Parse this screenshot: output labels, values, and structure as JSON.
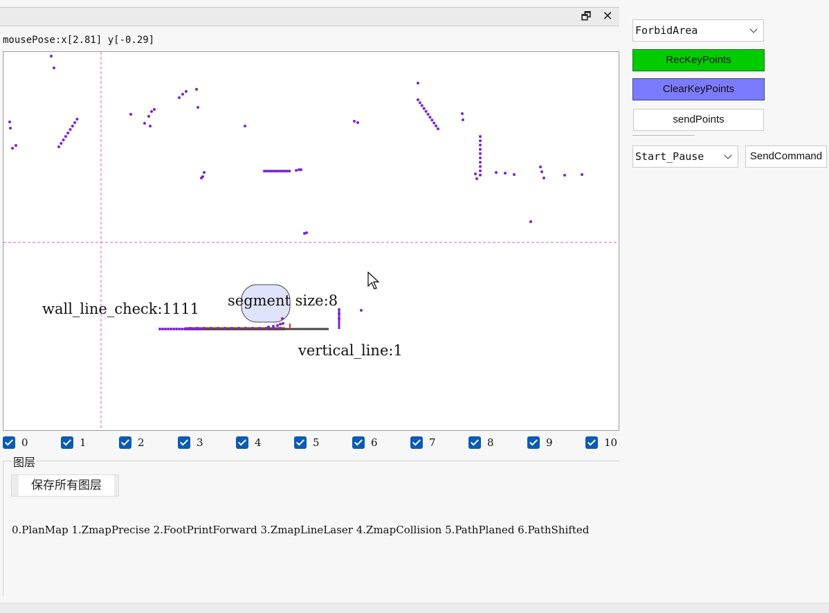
{
  "window": {
    "restore_icon": "restore-icon",
    "close_icon": "close-icon",
    "restore_glyph": "🗗",
    "close_glyph": "✕"
  },
  "mouse_pose": "mousePose:x[2.81] y[-0.29]",
  "canvas_labels": {
    "wall_line_check": "wall_line_check:1111",
    "segment_size": "segment size:8",
    "vertical_line": "vertical_line:1"
  },
  "layer_checkboxes": [
    {
      "label": "0",
      "checked": true
    },
    {
      "label": "1",
      "checked": true
    },
    {
      "label": "2",
      "checked": true
    },
    {
      "label": "3",
      "checked": true
    },
    {
      "label": "4",
      "checked": true
    },
    {
      "label": "5",
      "checked": true
    },
    {
      "label": "6",
      "checked": true
    },
    {
      "label": "7",
      "checked": true
    },
    {
      "label": "8",
      "checked": true
    },
    {
      "label": "9",
      "checked": true
    },
    {
      "label": "10",
      "checked": true
    }
  ],
  "layer_group": {
    "title": "图层",
    "save_button": "保存所有图层",
    "layers_text": "0.PlanMap 1.ZmapPrecise 2.FootPrintForward 3.ZmapLineLaser 4.ZmapCollision 5.PathPlaned 6.PathShifted"
  },
  "controls": {
    "area_combo": {
      "value": "ForbidArea"
    },
    "rec_key_points": {
      "label": "RecKeyPoints",
      "color": "#00cc00"
    },
    "clear_key_points": {
      "label": "ClearKeyPoints",
      "color": "#7b7bff"
    },
    "send_points": {
      "label": "sendPoints"
    },
    "command_combo": {
      "value": "Start_Pause"
    },
    "send_command": {
      "label": "SendCommand"
    }
  },
  "colors": {
    "points": "#7b22d6",
    "crosshair": "#d45ad4",
    "checkbox": "#0a5bb5"
  }
}
